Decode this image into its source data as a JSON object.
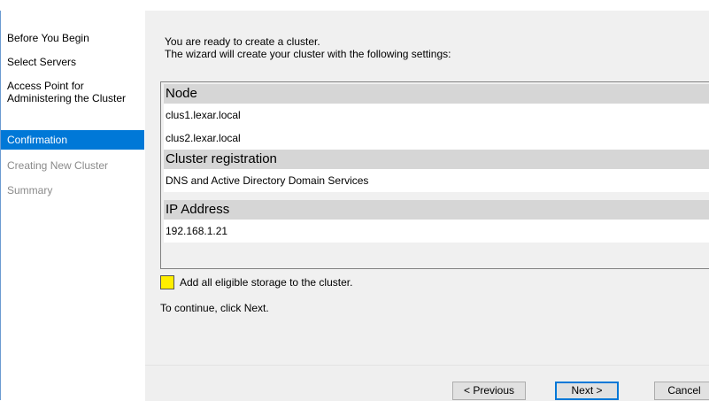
{
  "nav": {
    "items": [
      {
        "label": "Before You Begin",
        "state": "done"
      },
      {
        "label": "Select Servers",
        "state": "done"
      },
      {
        "label": "Access Point for Administering the Cluster",
        "state": "done"
      },
      {
        "label": "Confirmation",
        "state": "active"
      },
      {
        "label": "Creating New Cluster",
        "state": "disabled"
      },
      {
        "label": "Summary",
        "state": "disabled"
      }
    ]
  },
  "main": {
    "intro_line1": "You are ready to create a cluster.",
    "intro_line2": "The wizard will create your cluster with the following settings:",
    "sections": [
      {
        "header": "Node",
        "rows": [
          "clus1.lexar.local",
          "clus2.lexar.local"
        ]
      },
      {
        "header": "Cluster registration",
        "rows": [
          "DNS and Active Directory Domain Services"
        ]
      },
      {
        "header": "IP Address",
        "rows": [
          "192.168.1.21"
        ]
      }
    ],
    "storage_checkbox_label": "Add all eligible storage to the cluster.",
    "storage_checked": false,
    "continue_text": "To continue, click Next."
  },
  "footer": {
    "previous_label": "< Previous",
    "next_label": "Next >",
    "cancel_label": "Cancel"
  },
  "colors": {
    "active_nav": "#0078d7",
    "checkbox_highlight": "#ffee00"
  }
}
